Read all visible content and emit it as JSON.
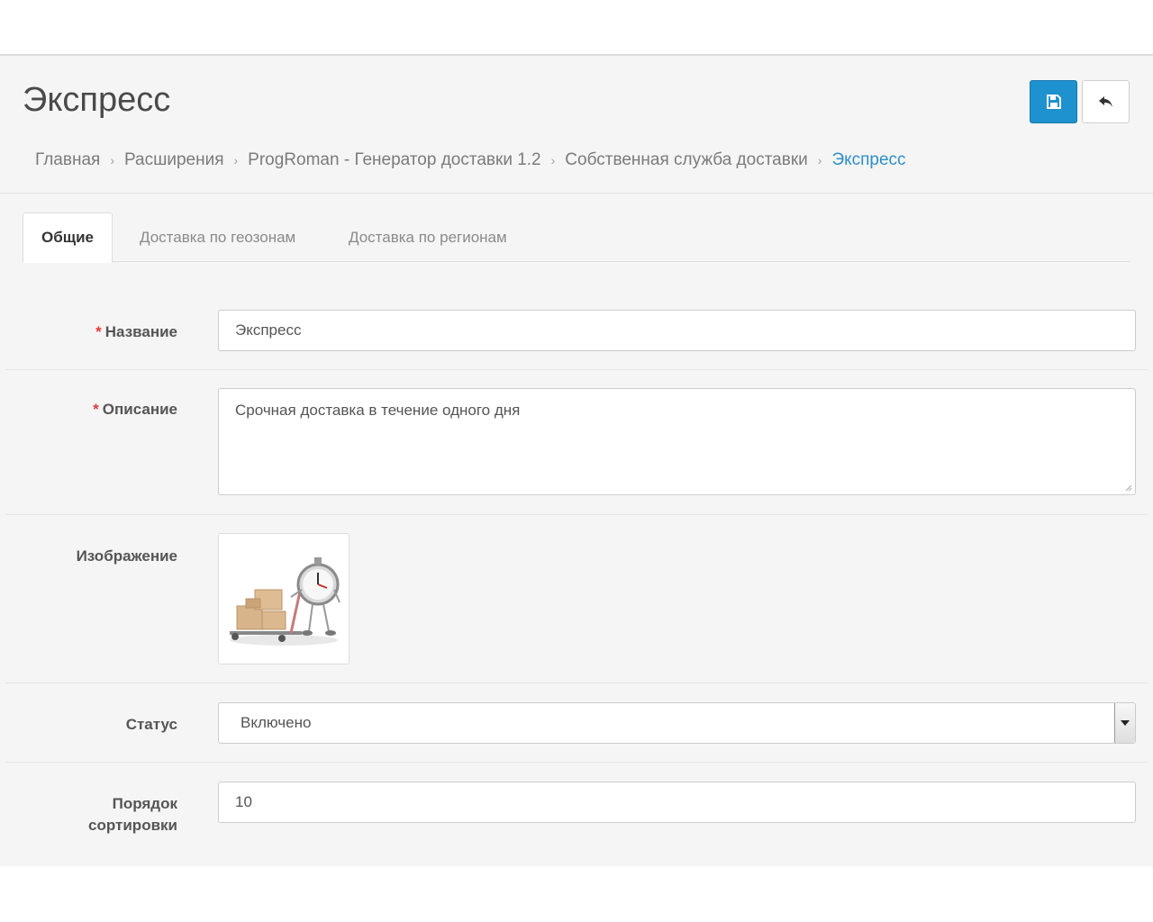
{
  "page": {
    "title": "Экспресс"
  },
  "toolbar": {
    "save_icon": "save-icon",
    "back_icon": "reply-icon",
    "save_color": "#1e91cf"
  },
  "breadcrumb": {
    "items": [
      {
        "label": "Главная"
      },
      {
        "label": "Расширения"
      },
      {
        "label": "ProgRoman - Генератор доставки 1.2"
      },
      {
        "label": "Собственная служба доставки"
      },
      {
        "label": "Экспресс"
      }
    ],
    "separator": "›",
    "active_color": "#2f8fc7"
  },
  "tabs": [
    {
      "label": "Общие",
      "active": true
    },
    {
      "label": "Доставка по геозонам",
      "active": false
    },
    {
      "label": "Доставка по регионам",
      "active": false
    }
  ],
  "form": {
    "required_mark": "*",
    "name": {
      "label": "Название",
      "value": "Экспресс"
    },
    "description": {
      "label": "Описание",
      "value": "Срочная доставка в течение одного дня"
    },
    "image": {
      "label": "Изображение",
      "icon": "delivery-stopwatch-image"
    },
    "status": {
      "label": "Статус",
      "value": "Включено"
    },
    "sort_order": {
      "label_line1": "Порядок",
      "label_line2": "сортировки",
      "value": "10"
    }
  }
}
